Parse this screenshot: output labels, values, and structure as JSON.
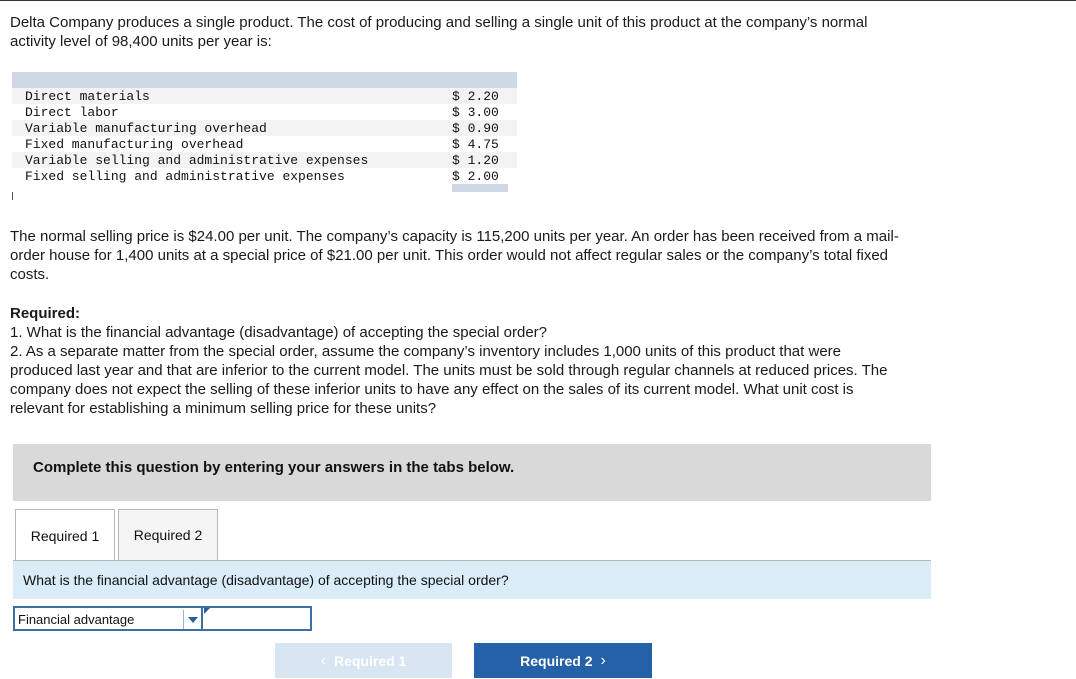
{
  "intro": {
    "line1": "Delta Company produces a single product. The cost of producing and selling a single unit of this product at the company’s normal",
    "line2": "activity level of 98,400 units per year is:"
  },
  "cost_table": {
    "rows": [
      {
        "label": "Direct materials",
        "value": "$ 2.20"
      },
      {
        "label": "Direct labor",
        "value": "$ 3.00"
      },
      {
        "label": "Variable manufacturing overhead",
        "value": "$ 0.90"
      },
      {
        "label": "Fixed manufacturing overhead",
        "value": "$ 4.75"
      },
      {
        "label": "Variable selling and administrative expenses",
        "value": "$ 1.20"
      },
      {
        "label": "Fixed selling and administrative expenses",
        "value": "$ 2.00"
      }
    ]
  },
  "normal_price": {
    "line1": "The normal selling price is $24.00 per unit. The company’s capacity is 115,200 units per year. An order has been received from a mail-",
    "line2": "order house for 1,400 units at a special price of $21.00 per unit. This order would not affect regular sales or the company’s total fixed",
    "line3": "costs."
  },
  "required": {
    "heading": "Required:",
    "q1": "1. What is the financial advantage (disadvantage) of accepting the special order?",
    "q2_line1": "2. As a separate matter from the special order, assume the company’s inventory includes 1,000 units of this product that were",
    "q2_line2": "produced last year and that are inferior to the current model. The units must be sold through regular channels at reduced prices. The",
    "q2_line3": "company does not expect the selling of these inferior units to have any effect on the sales of its current model. What unit cost is",
    "q2_line4": "relevant for establishing a minimum selling price for these units?"
  },
  "instructions": "Complete this question by entering your answers in the tabs below.",
  "tabs": [
    {
      "label": "Required 1",
      "active": true
    },
    {
      "label": "Required 2",
      "active": false
    }
  ],
  "question": "What is the financial advantage (disadvantage) of accepting the special order?",
  "answer": {
    "select_value": "Financial advantage",
    "input_value": ""
  },
  "nav": {
    "prev_label": "Required 1",
    "next_label": "Required 2",
    "prev_icon": "chevron-left-icon",
    "next_icon": "chevron-right-icon"
  },
  "colors": {
    "next_button": "#2561a8",
    "prev_button_disabled": "#d8e5f3",
    "question_bar": "#d9ecf7",
    "instructions_panel": "#d9d9d9",
    "table_header_bar": "#cfd9e6"
  }
}
